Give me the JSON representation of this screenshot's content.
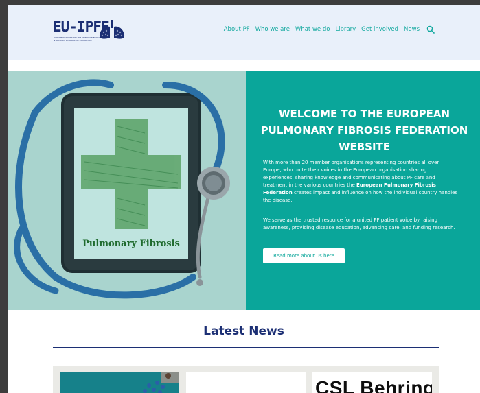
{
  "header": {
    "logo_text": "EU-IPFF",
    "logo_sub": "EUROPEAN IDIOPATHIC PULMONARY FIBROSIS & RELATED DISORDERS FEDERATION",
    "nav": [
      "About PF",
      "Who we are",
      "What we do",
      "Library",
      "Get involved",
      "News"
    ],
    "search_icon": "search-icon"
  },
  "hero": {
    "image_caption": "Pulmonary Fibrosis",
    "title": "WELCOME TO THE EUROPEAN PULMONARY FIBROSIS FEDERATION WEBSITE",
    "p1_before": "With more than 20 member organisations representing countries all over Europe, who unite their voices in the European organisation sharing experiences, sharing knowledge and communicating about PF care and treatment in the various countries the ",
    "p1_bold": "European Pulmonary Fibrosis Federation",
    "p1_after": " creates impact and influence on how the individual country handles the disease.",
    "p2": "We serve as the trusted resource for a united PF patient voice by raising awareness, providing disease education, advancing care, and funding research.",
    "button": "Read more about us here"
  },
  "latest": {
    "title": "Latest News",
    "card3_text": "CSL Behring"
  },
  "colors": {
    "navy": "#1c2f74",
    "teal": "#0aa69a",
    "header_bg": "#e9f0fa"
  }
}
